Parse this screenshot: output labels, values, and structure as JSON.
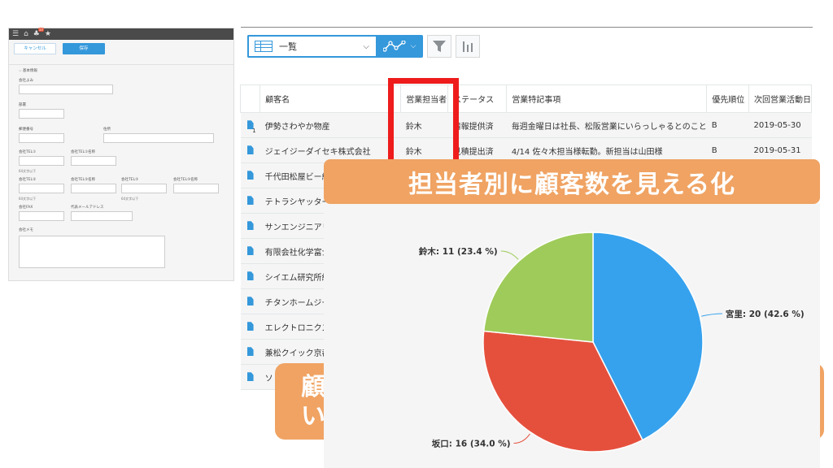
{
  "form_window": {
    "topbar_badge": "10",
    "cancel_label": "キャンセル",
    "save_label": "保存",
    "section_label": "基本情報",
    "fields": {
      "company_kana": "会社よみ",
      "department": "部署",
      "postal_code": "郵便番号",
      "address": "住所",
      "tel1": "会社TEL①",
      "tel1_name": "会社TEL①名称",
      "tel2": "会社TEL②",
      "tel2_name": "会社TEL②名称",
      "tel3": "会社TEL③",
      "tel3_name": "会社TEL③名称",
      "fax": "会社FAX",
      "rep_email": "代表メールアドレス",
      "memo": "会社メモ"
    },
    "char_limit_note": "64文字以下"
  },
  "toolbar": {
    "view_label": "一覧"
  },
  "table": {
    "headers": [
      "顧客名",
      "営業担当者",
      "ステータス",
      "営業特記事項",
      "優先順位",
      "次回営業活動日"
    ],
    "rows": [
      [
        "伊勢さわやか物産",
        "鈴木",
        "情報提供済",
        "毎週金曜日は社長、松阪営業にいらっしゃるとのこと",
        "B",
        "2019-05-30"
      ],
      [
        "ジェイジーダイセキ株式会社",
        "鈴木",
        "見積提出済",
        "4/14 佐々木担当様転勤。新担当は山田様",
        "B",
        "2019-05-31"
      ],
      [
        "千代田松屋ビー組",
        "",
        "",
        "",
        "",
        ""
      ],
      [
        "テトラシヤッター",
        "",
        "",
        "",
        "",
        ""
      ],
      [
        "サンエンジニアリ",
        "",
        "",
        "",
        "",
        ""
      ],
      [
        "有限会社化学富士",
        "",
        "",
        "",
        "",
        ""
      ],
      [
        "シイエム研究所組",
        "",
        "",
        "",
        "",
        ""
      ],
      [
        "チタンホームジー",
        "",
        "",
        "",
        "",
        ""
      ],
      [
        "エレクトロニクス",
        "",
        "",
        "",
        "",
        ""
      ],
      [
        "兼松クイック京都",
        "",
        "",
        "",
        "",
        ""
      ],
      [
        "ソ",
        "",
        "",
        "",
        "",
        ""
      ]
    ],
    "first_row_number": "1"
  },
  "banner": {
    "title": "担当者別に顧客数を見える化",
    "secondary_line1": "顧",
    "secondary_line2": "い"
  },
  "colors": {
    "accent_blue": "#3498db",
    "banner_orange": "#f0a363",
    "highlight_red": "#ee1c1c",
    "pie_blue": "#36a2ee",
    "pie_red": "#e5503d",
    "pie_green": "#9fcb5a"
  },
  "chart_data": {
    "type": "pie",
    "title": "",
    "slices": [
      {
        "name": "宮里",
        "value": 20,
        "percent": 42.6,
        "color": "#36a2ee",
        "label": "宮里: 20 (42.6 %)"
      },
      {
        "name": "坂口",
        "value": 16,
        "percent": 34.0,
        "color": "#e5503d",
        "label": "坂口: 16 (34.0 %)"
      },
      {
        "name": "鈴木",
        "value": 11,
        "percent": 23.4,
        "color": "#9fcb5a",
        "label": "鈴木: 11 (23.4 %)"
      }
    ]
  }
}
